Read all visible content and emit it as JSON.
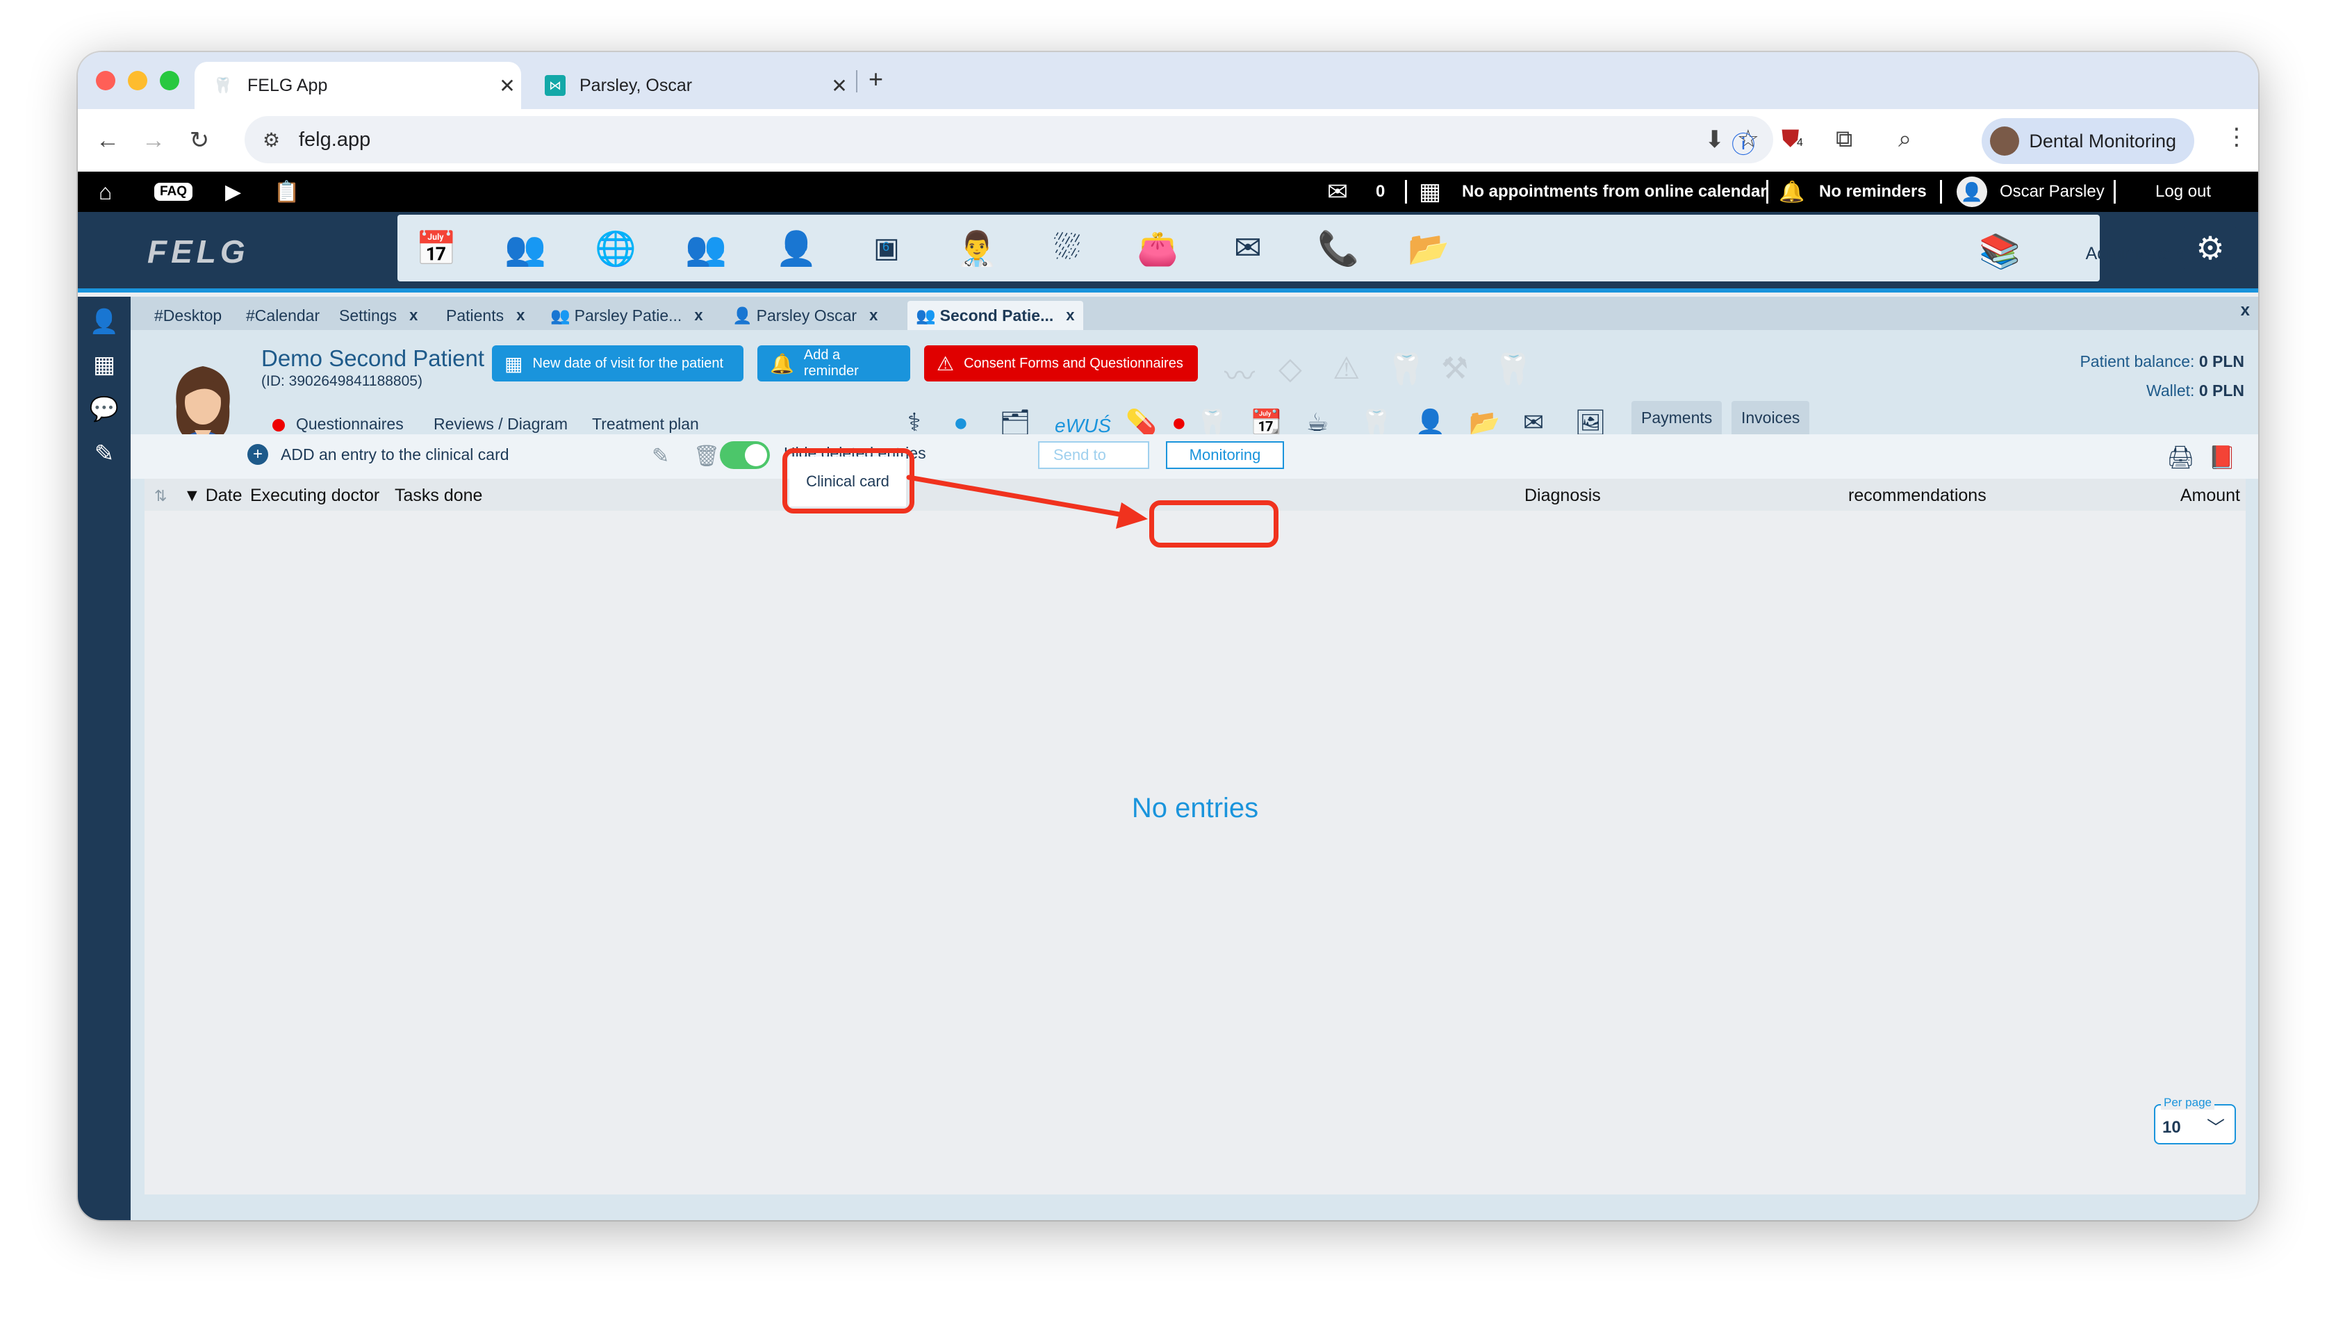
{
  "browser": {
    "tabs": [
      {
        "title": "FELG App",
        "icon": "felg-tooth-icon"
      },
      {
        "title": "Parsley, Oscar",
        "icon": "bowtie-icon"
      }
    ],
    "new_tab": "+",
    "url": "felg.app",
    "profile_name": "Dental Monitoring",
    "extension_badge": "4"
  },
  "topbar": {
    "faq": "FAQ",
    "mail_count": "0",
    "calendar_text": "No appointments from online calendar",
    "reminders_text": "No reminders",
    "user_name": "Oscar Parsley",
    "logout": "Log out"
  },
  "nav": {
    "logo": "FELG",
    "admin_label": "Administration",
    "calendar_day": "6"
  },
  "patient_tabs": [
    {
      "label": "#Desktop",
      "closable": false
    },
    {
      "label": "#Calendar",
      "closable": false
    },
    {
      "label": "Settings",
      "closable": true
    },
    {
      "label": "Patients",
      "closable": true
    },
    {
      "label": "Parsley Patie...",
      "closable": true
    },
    {
      "label": "Parsley Oscar",
      "closable": true
    },
    {
      "label": "Second Patie...",
      "closable": true,
      "active": true
    }
  ],
  "tabs_close_all": "x",
  "patient": {
    "name": "Demo Second Patient",
    "id": "(ID: 3902649841188805)",
    "balance_label": "Patient balance:",
    "balance_value": "0 PLN",
    "wallet_label": "Wallet:",
    "wallet_value": "0 PLN"
  },
  "actions": {
    "new_visit": "New date of visit for the patient",
    "add_reminder": "Add a reminder",
    "consent": "Consent Forms and Questionnaires"
  },
  "subtabs": {
    "questionnaires": "Questionnaires",
    "reviews": "Reviews / Diagram",
    "treatment": "Treatment plan",
    "clinical_card": "Clinical card",
    "wus": "eWUŚ",
    "payments": "Payments",
    "invoices": "Invoices"
  },
  "toolbar_row": {
    "add_entry": "ADD an entry to the clinical card",
    "hide_deleted": "Hide deleted entries",
    "hide_deleted_on": true,
    "send_to": "Send to",
    "monitoring": "Monitoring"
  },
  "table": {
    "columns": [
      "▼ Date",
      "Executing doctor",
      "Tasks done",
      "Diagnosis",
      "recommendations",
      "Amount"
    ],
    "empty_text": "No entries",
    "per_page_label": "Per page",
    "per_page_value": "10"
  },
  "colors": {
    "navy": "#1e3a57",
    "accent": "#1a94dc",
    "highlight": "#f0321e",
    "consent_red": "#e00000",
    "toggle_green": "#4cc66a"
  }
}
